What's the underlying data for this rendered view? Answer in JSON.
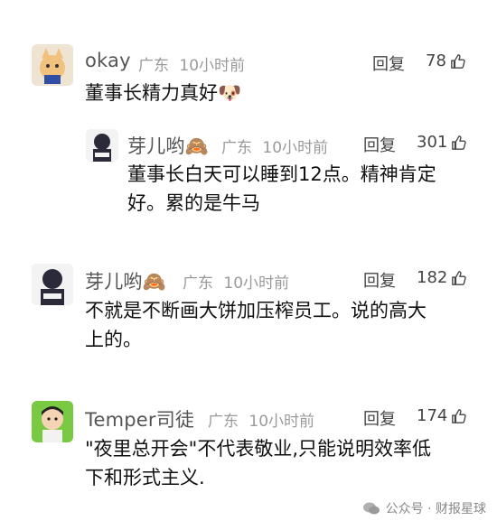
{
  "comments": [
    {
      "name": "okay",
      "location": "广东",
      "time": "10小时前",
      "reply_label": "回复",
      "likes": "78",
      "body": "董事长精力真好🐶"
    },
    {
      "name": "芽儿哟🙈",
      "location": "广东",
      "time": "10小时前",
      "reply_label": "回复",
      "likes": "301",
      "body": "董事长白天可以睡到12点。精神肯定\n好。累的是牛马"
    },
    {
      "name": "芽儿哟🙈",
      "location": "广东",
      "time": "10小时前",
      "reply_label": "回复",
      "likes": "182",
      "body": "不就是不断画大饼加压榨员工。说的高大\n上的。"
    },
    {
      "name": "Temper司徒",
      "location": "广东",
      "time": "10小时前",
      "reply_label": "回复",
      "likes": "174",
      "body": "\"夜里总开会\"不代表敬业,只能说明效率低\n下和形式主义."
    }
  ],
  "watermark": {
    "text": "公众号 · 财报星球"
  },
  "icons": {
    "like": "thumbs-up-icon",
    "wechat": "wechat-icon"
  }
}
